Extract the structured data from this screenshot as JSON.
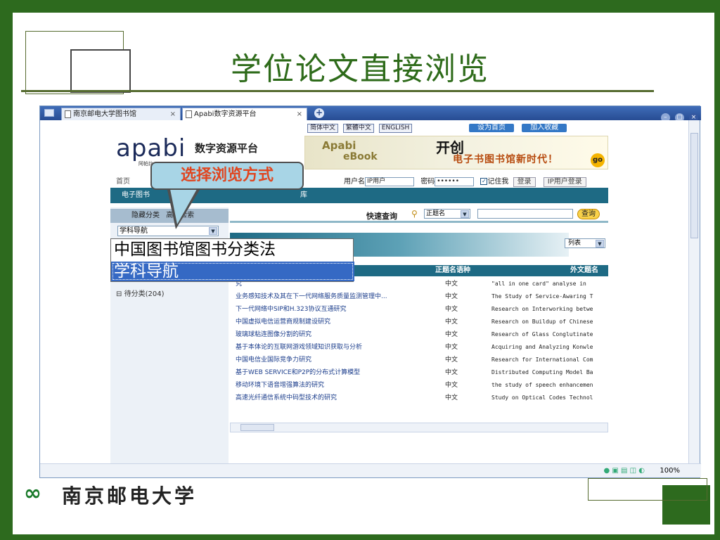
{
  "slide": {
    "title": "学位论文直接浏览",
    "university": "南京邮电大学"
  },
  "browser": {
    "tabs": [
      {
        "label": "南京邮电大学图书馆",
        "close": "×"
      },
      {
        "label": "Apabi数字资源平台",
        "close": "×"
      }
    ],
    "new_tab": "+",
    "window_buttons": [
      "–",
      "▢",
      "×"
    ],
    "zoom": "100%"
  },
  "header": {
    "logo": "apabi",
    "logo_sub": "阿帕比",
    "platform_name": "数字资源平台",
    "lang_links": [
      "简体中文",
      "繁體中文",
      "ENGLISH"
    ],
    "top_actions": [
      "设为首页",
      "加入收藏"
    ],
    "banner": {
      "line1": "Apabi",
      "line2": "eBook",
      "headline": "开创",
      "tagline": "电子书图书馆新时代！",
      "go": "go"
    }
  },
  "nav": {
    "home": "首页",
    "bar_text": "电子图书",
    "bar_text_right": "库"
  },
  "login": {
    "username_label": "用户名",
    "username_value": "IP用户",
    "password_label": "密码",
    "password_value": "••••••",
    "remember_label": "记住我",
    "login_button": "登录",
    "ip_login_button": "IP用户登录"
  },
  "sidebar": {
    "toggle_label": "隐藏分类",
    "advanced_label": "高级检索",
    "select_value": "学科导航",
    "dropdown_options": [
      "中国图书馆图书分类法",
      "学科导航"
    ],
    "tree_item": "待分类(204)"
  },
  "search": {
    "label": "快速查询",
    "field_select": "正题名",
    "query": "",
    "button": "查询",
    "view_select": "列表"
  },
  "callout": "选择浏览方式",
  "table": {
    "headers": [
      "正题名语种",
      "外文题名"
    ],
    "rows": [
      {
        "title": "究",
        "lang": "中文",
        "en": "\"all in one card\" analyse in"
      },
      {
        "title": "业务感知技术及其在下一代网络服务质量监测管理中...",
        "lang": "中文",
        "en": "The Study of Service-Awaring T"
      },
      {
        "title": "下一代网络中SIP和H.323协议互通研究",
        "lang": "中文",
        "en": "Research on Interworking betwe"
      },
      {
        "title": "中国虚拟电信运营商规制建设研究",
        "lang": "中文",
        "en": "Research on Buildup of Chinese"
      },
      {
        "title": "玻璃球粘连图像分割的研究",
        "lang": "中文",
        "en": "Research of Glass Conglutinate"
      },
      {
        "title": "基于本体论的互联网游戏领域知识获取与分析",
        "lang": "中文",
        "en": "Acquiring and Analyzing Konwle"
      },
      {
        "title": "中国电信业国际竞争力研究",
        "lang": "中文",
        "en": "Research for International Com"
      },
      {
        "title": "基于WEB SERVICE和P2P的分布式计算模型",
        "lang": "中文",
        "en": "Distributed Computing Model Ba"
      },
      {
        "title": "移动环境下语音增强算法的研究",
        "lang": "中文",
        "en": "the study of speech enhancemen"
      },
      {
        "title": "高速光纤通信系统中码型技术的研究",
        "lang": "中文",
        "en": "Study on Optical Codes Technol"
      }
    ]
  }
}
